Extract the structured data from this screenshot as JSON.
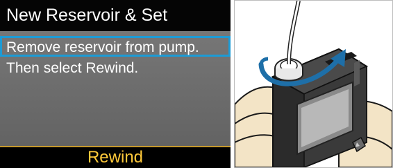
{
  "screen": {
    "title": "New Reservoir & Set",
    "lines": [
      "Remove reservoir from pump.",
      "Then select Rewind."
    ],
    "action": "Rewind"
  },
  "colors": {
    "title_bg": "#050505",
    "screen_bg": "#6f6f6f",
    "highlight": "#1c9bd6",
    "action_text": "#ffc93a",
    "arrow": "#1e6fa8"
  },
  "illustration": {
    "description_icon": "hand-holding-pump-illustration",
    "arrow_icon": "counterclockwise-arrow-icon"
  }
}
